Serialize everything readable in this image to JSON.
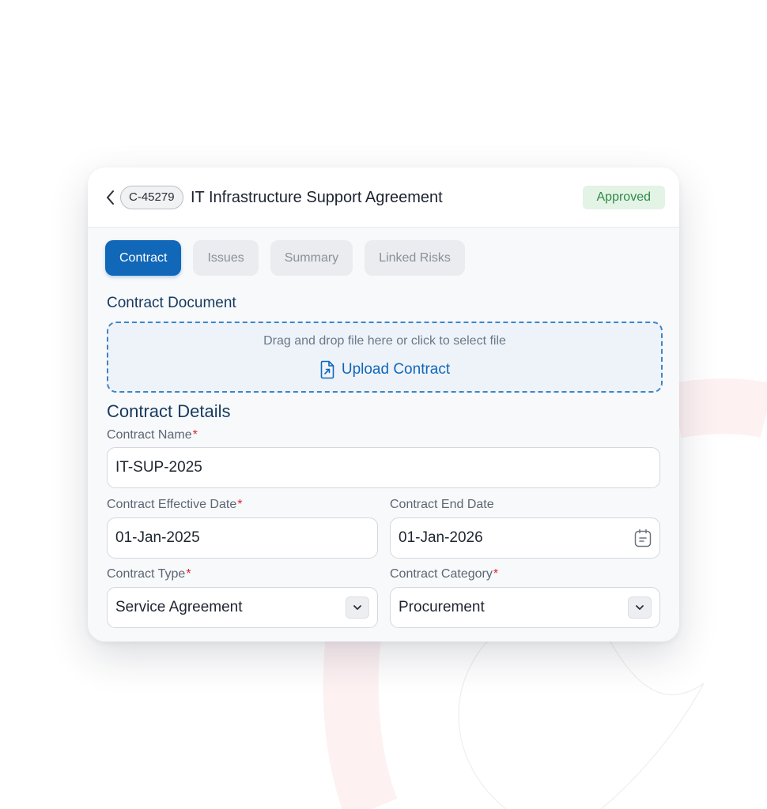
{
  "header": {
    "contract_id": "C-45279",
    "title": "IT Infrastructure Support Agreement",
    "status": "Approved"
  },
  "tabs": [
    {
      "label": "Contract",
      "active": true
    },
    {
      "label": "Issues",
      "active": false
    },
    {
      "label": "Summary",
      "active": false
    },
    {
      "label": "Linked Risks",
      "active": false
    }
  ],
  "document": {
    "section_label": "Contract Document",
    "drop_hint": "Drag and drop file here or click to select file",
    "upload_label": "Upload Contract",
    "upload_icon": "file-upload-icon"
  },
  "details": {
    "title": "Contract Details",
    "name": {
      "label": "Contract Name",
      "value": "IT-SUP-2025"
    },
    "effective_date": {
      "label": "Contract Effective Date",
      "value": "01-Jan-2025"
    },
    "end_date": {
      "label": "Contract End Date",
      "value": "01-Jan-2026"
    },
    "type": {
      "label": "Contract Type",
      "value": "Service Agreement"
    },
    "category": {
      "label": "Contract Category",
      "value": "Procurement"
    },
    "required_marker": "*"
  },
  "colors": {
    "accent": "#1167b8",
    "status_bg": "#e3f3e6",
    "status_text": "#2e8a43",
    "required": "#e0232e",
    "heading": "#163a5e"
  }
}
